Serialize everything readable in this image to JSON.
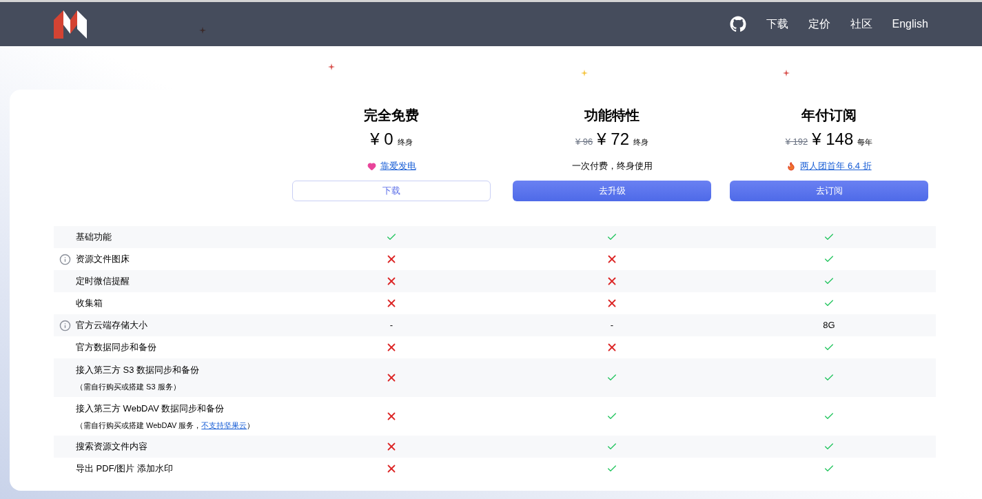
{
  "nav": {
    "items": [
      {
        "label": "下载"
      },
      {
        "label": "定价"
      },
      {
        "label": "社区"
      },
      {
        "label": "English"
      }
    ]
  },
  "plans": [
    {
      "title": "完全免费",
      "price": "¥ 0",
      "unit": "终身",
      "extra": {
        "kind": "donate",
        "text": "靠爱发电"
      },
      "button": {
        "label": "下载",
        "kind": "outline"
      }
    },
    {
      "title": "功能特性",
      "original_price": "¥ 96",
      "price": "¥ 72",
      "unit": "终身",
      "extra": {
        "kind": "text",
        "text": "一次付费，终身使用"
      },
      "button": {
        "label": "去升级",
        "kind": "filled"
      }
    },
    {
      "title": "年付订阅",
      "original_price": "¥ 192",
      "price": "¥ 148",
      "unit": "每年",
      "extra": {
        "kind": "promo",
        "text": "两人团首年 6.4 折"
      },
      "button": {
        "label": "去订阅",
        "kind": "filled"
      }
    }
  ],
  "features": [
    {
      "label": "基础功能",
      "info": false,
      "values": [
        {
          "kind": "check"
        },
        {
          "kind": "check"
        },
        {
          "kind": "check"
        }
      ]
    },
    {
      "label": "资源文件图床",
      "info": true,
      "values": [
        {
          "kind": "cross"
        },
        {
          "kind": "cross"
        },
        {
          "kind": "check"
        }
      ]
    },
    {
      "label": "定时微信提醒",
      "info": false,
      "values": [
        {
          "kind": "cross"
        },
        {
          "kind": "cross"
        },
        {
          "kind": "check"
        }
      ]
    },
    {
      "label": "收集箱",
      "info": false,
      "values": [
        {
          "kind": "cross"
        },
        {
          "kind": "cross"
        },
        {
          "kind": "check"
        }
      ]
    },
    {
      "label": "官方云端存储大小",
      "info": true,
      "values": [
        {
          "kind": "text",
          "text": "-"
        },
        {
          "kind": "text",
          "text": "-"
        },
        {
          "kind": "text",
          "text": "8G"
        }
      ]
    },
    {
      "label": "官方数据同步和备份",
      "info": false,
      "values": [
        {
          "kind": "cross"
        },
        {
          "kind": "cross"
        },
        {
          "kind": "check"
        }
      ]
    },
    {
      "label": "接入第三方 S3 数据同步和备份",
      "note": "（需自行购买或搭建 S3 服务）",
      "info": false,
      "values": [
        {
          "kind": "cross"
        },
        {
          "kind": "check"
        },
        {
          "kind": "check"
        }
      ]
    },
    {
      "label": "接入第三方 WebDAV 数据同步和备份",
      "note": "（需自行购买或搭建 WebDAV 服务，",
      "note_link": "不支持坚果云",
      "note_end": "）",
      "info": false,
      "values": [
        {
          "kind": "cross"
        },
        {
          "kind": "check"
        },
        {
          "kind": "check"
        }
      ]
    },
    {
      "label": "搜索资源文件内容",
      "info": false,
      "values": [
        {
          "kind": "cross"
        },
        {
          "kind": "check"
        },
        {
          "kind": "check"
        }
      ]
    },
    {
      "label": "导出 PDF/图片 添加水印",
      "info": false,
      "values": [
        {
          "kind": "cross"
        },
        {
          "kind": "check"
        },
        {
          "kind": "check"
        }
      ]
    }
  ]
}
